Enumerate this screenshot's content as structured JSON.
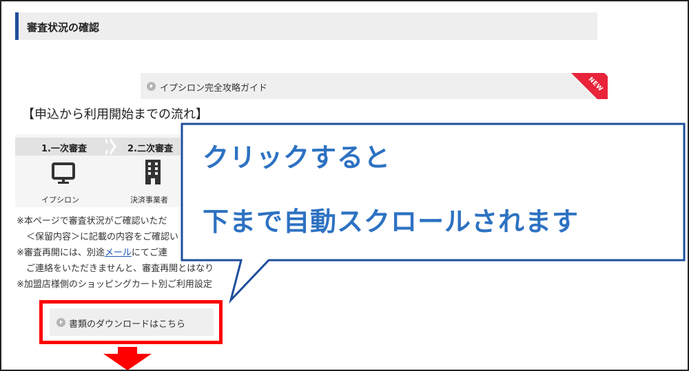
{
  "section": {
    "title": "審査状況の確認"
  },
  "guide": {
    "label": "イプシロン完全攻略ガイド",
    "badge": "NEW"
  },
  "flow": {
    "title": "【申込から利用開始までの流れ】",
    "steps": [
      {
        "label": "1.一次審査",
        "sub": "イプシロン"
      },
      {
        "label": "2.二次審査",
        "sub": "決済事業者"
      }
    ]
  },
  "notes": {
    "line1": "※本ページで審査状況がご確認いただ",
    "line2": "＜保留内容＞に記載の内容をご確認い",
    "line3_pre": "※審査再開には、別途",
    "line3_link": "メール",
    "line3_post": "にてご連",
    "line4": "ご連絡をいただきませんと、審査再開とはなり",
    "line5": "※加盟店様側のショッピングカート別ご利用設定"
  },
  "download": {
    "label": "書類のダウンロードはこちら"
  },
  "callout": {
    "line1": "クリックすると",
    "line2": "下まで自動スクロールされます"
  },
  "colors": {
    "accent": "#1f4e9c",
    "callout_text": "#2d72c2",
    "highlight": "#ff0000",
    "badge": "#e8233a"
  }
}
